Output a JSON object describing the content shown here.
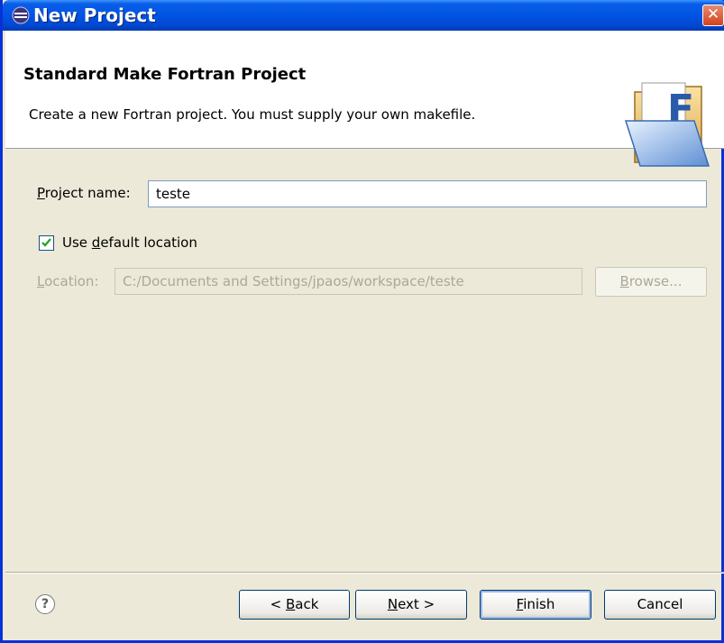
{
  "window": {
    "title": "New Project"
  },
  "header": {
    "title": "Standard Make Fortran Project",
    "description": "Create a new Fortran project.  You must supply your own makefile."
  },
  "form": {
    "project_name_label_prefix": "P",
    "project_name_label_rest": "roject name:",
    "project_name_value": "teste",
    "use_default_checked": true,
    "use_default_label_prefix": "Use ",
    "use_default_label_u": "d",
    "use_default_label_rest": "efault location",
    "location_label_prefix": "L",
    "location_label_rest": "ocation:",
    "location_value": "C:/Documents and Settings/jpaos/workspace/teste",
    "browse_label_prefix": "B",
    "browse_label_rest": "rowse..."
  },
  "buttons": {
    "back_prefix": "< ",
    "back_u": "B",
    "back_rest": "ack",
    "next_u": "N",
    "next_rest": "ext >",
    "finish_u": "F",
    "finish_rest": "inish",
    "cancel": "Cancel"
  },
  "help_glyph": "?",
  "close_glyph": "✕",
  "icons": {
    "title": "eclipse-icon",
    "header": "fortran-folder-icon",
    "help": "help-icon"
  }
}
